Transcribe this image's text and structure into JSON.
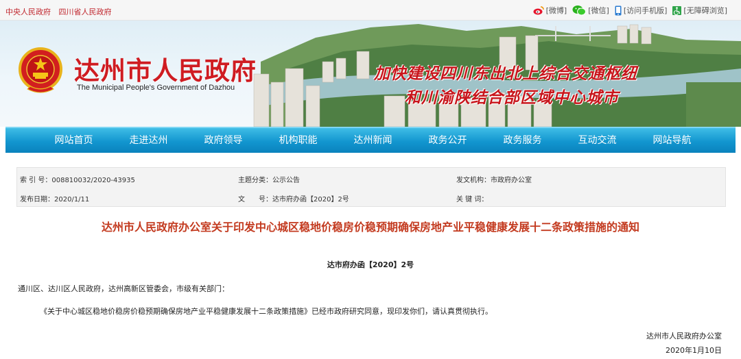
{
  "top_links": [
    "中央人民政府",
    "四川省人民政府"
  ],
  "top_right": {
    "weibo": "[微博]",
    "wechat": "[微信]",
    "mobile": "[访问手机版]",
    "accessible": "[无障碍浏览]"
  },
  "header": {
    "title": "达州市人民政府",
    "subtitle": "The Municipal People's Government of Dazhou",
    "slogan_line1": "加快建设四川东出北上综合交通枢纽",
    "slogan_line2": "和川渝陕结合部区域中心城市"
  },
  "nav": [
    "网站首页",
    "走进达州",
    "政府领导",
    "机构职能",
    "达州新闻",
    "政务公开",
    "政务服务",
    "互动交流",
    "网站导航"
  ],
  "meta": {
    "index_no": "索 引 号：008810032/2020-43935",
    "topic": "主题分类：公示公告",
    "issuer": "发文机构：市政府办公室",
    "date": "发布日期：2020/1/11",
    "doc_label": "文　　号：达市府办函【2020】2号",
    "keywords": "关 键 词："
  },
  "document": {
    "title": "达州市人民政府办公室关于印发中心城区稳地价稳房价稳预期确保房地产业平稳健康发展十二条政策措施的通知",
    "number": "达市府办函【2020】2号",
    "recipients": "通川区、达川区人民政府，达州高新区管委会，市级有关部门：",
    "body": "《关于中心城区稳地价稳房价稳预期确保房地产业平稳健康发展十二条政策措施》已经市政府研究同意，现印发你们，请认真贯彻执行。",
    "signature_org": "达州市人民政府办公室",
    "signature_date": "2020年1月10日"
  },
  "colors": {
    "accent_red": "#cf1c22",
    "nav_blue": "#1296cf",
    "title_red": "#c33a1f"
  }
}
